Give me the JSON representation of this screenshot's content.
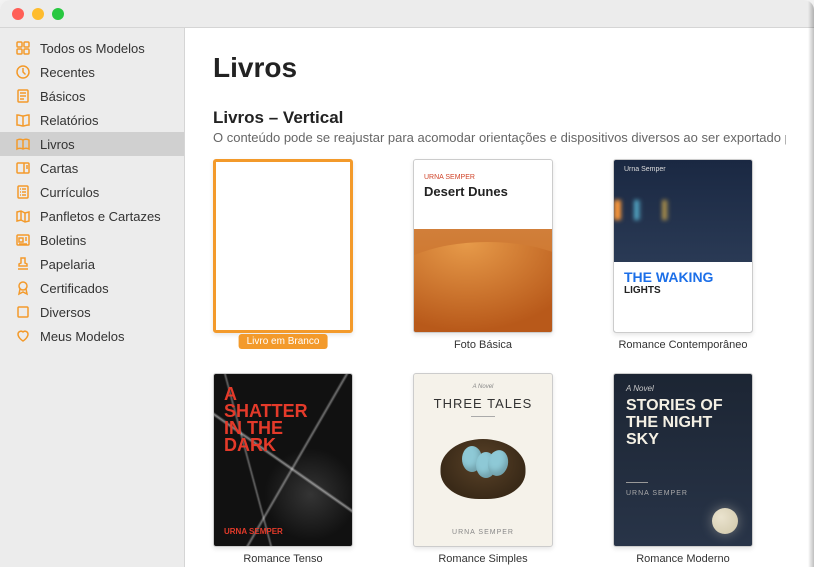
{
  "sidebar": {
    "items": [
      {
        "label": "Todos os Modelos",
        "icon": "grid"
      },
      {
        "label": "Recentes",
        "icon": "clock"
      },
      {
        "label": "Básicos",
        "icon": "doc-lines"
      },
      {
        "label": "Relatórios",
        "icon": "book-open"
      },
      {
        "label": "Livros",
        "icon": "book",
        "selected": true
      },
      {
        "label": "Cartas",
        "icon": "postcard"
      },
      {
        "label": "Currículos",
        "icon": "doc-list"
      },
      {
        "label": "Panfletos e Cartazes",
        "icon": "map"
      },
      {
        "label": "Boletins",
        "icon": "newspaper"
      },
      {
        "label": "Papelaria",
        "icon": "stamp"
      },
      {
        "label": "Certificados",
        "icon": "ribbon"
      },
      {
        "label": "Diversos",
        "icon": "square"
      },
      {
        "label": "Meus Modelos",
        "icon": "heart"
      }
    ]
  },
  "main": {
    "title": "Livros",
    "section": {
      "title": "Livros – Vertical",
      "desc": "O conteúdo pode se reajustar para acomodar orientações e dispositivos diversos ao ser exportado para EPUB. Me"
    },
    "templates": [
      {
        "caption": "Livro em Branco",
        "selected": true,
        "kind": "blank"
      },
      {
        "caption": "Foto Básica",
        "kind": "desert",
        "cover": {
          "author": "URNA SEMPER",
          "title": "Desert Dunes"
        }
      },
      {
        "caption": "Romance Contemporâneo",
        "kind": "waking",
        "cover": {
          "author": "Urna Semper",
          "title1": "THE WAKING",
          "title2": "LIGHTS"
        }
      },
      {
        "caption": "Romance Tenso",
        "kind": "shatter",
        "cover": {
          "title": "A\nSHATTER\nIN THE\nDARK",
          "author": "URNA SEMPER"
        }
      },
      {
        "caption": "Romance Simples",
        "kind": "tales",
        "cover": {
          "top": "A Novel",
          "title": "THREE TALES",
          "author": "URNA SEMPER"
        }
      },
      {
        "caption": "Romance Moderno",
        "kind": "night",
        "cover": {
          "top": "A Novel",
          "title": "STORIES OF THE NIGHT SKY",
          "author": "URNA SEMPER"
        }
      }
    ]
  }
}
